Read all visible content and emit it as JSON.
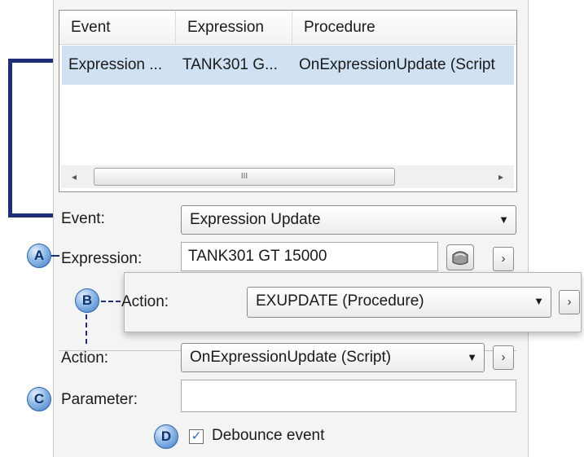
{
  "list": {
    "columns": [
      "Event",
      "Expression",
      "Procedure"
    ],
    "rows": [
      [
        "Expression ...",
        "TANK301 G...",
        "OnExpressionUpdate (Script"
      ]
    ],
    "scroll_grip": "III"
  },
  "form": {
    "event_label": "Event:",
    "event_value": "Expression Update",
    "expression_label": "Expression:",
    "expression_value": "TANK301 GT 15000",
    "action_label": "Action:",
    "action_value": "OnExpressionUpdate (Script)",
    "parameter_label": "Parameter:",
    "parameter_value": "",
    "debounce_label": "Debounce event",
    "debounce_checked": true
  },
  "popout": {
    "action_label": "Action:",
    "action_value": "EXUPDATE (Procedure)"
  },
  "badges": {
    "a": "A",
    "b": "B",
    "c": "C",
    "d": "D"
  },
  "icons": {
    "dropdown": "▼",
    "more": "›",
    "scroll_left": "◂",
    "scroll_right": "▸",
    "check": "✓"
  },
  "colors": {
    "accent_bracket": "#1f2e75",
    "selected_row": "#cfe1f3",
    "badge": "#3f7cc8"
  }
}
